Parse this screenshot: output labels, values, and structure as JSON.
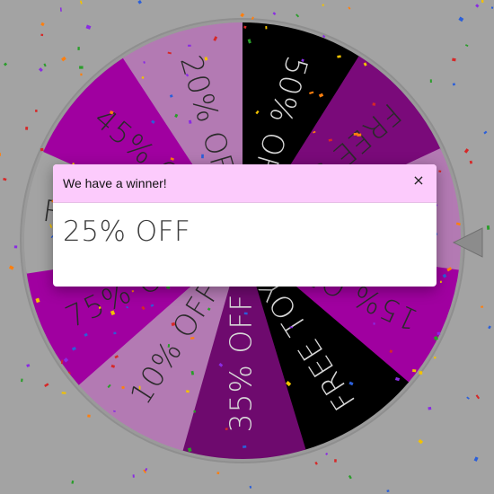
{
  "wheel": {
    "segments": [
      {
        "label": "50% OFF",
        "color": "#000000",
        "text_color": "#d8d8d8"
      },
      {
        "label": "FREE SHIP",
        "color": "#7a0a7a",
        "text_color": "#2a2a2a"
      },
      {
        "label": "25% OFF",
        "color": "#b37ab3",
        "text_color": "#2a2a2a"
      },
      {
        "label": "15% OFF",
        "color": "#a000a0",
        "text_color": "#2a2a2a"
      },
      {
        "label": "FREE TOY",
        "color": "#000000",
        "text_color": "#d8d8d8"
      },
      {
        "label": "35% OFF",
        "color": "#6e0a6e",
        "text_color": "#d8d8d8"
      },
      {
        "label": "10% OFF",
        "color": "#b37ab3",
        "text_color": "#2a2a2a"
      },
      {
        "label": "75% OFF",
        "color": "#a000a0",
        "text_color": "#2a2a2a"
      },
      {
        "label": "FREE GIFT",
        "color": "#a3a3a3",
        "text_color": "#2a2a2a"
      },
      {
        "label": "45% OFF",
        "color": "#a000a0",
        "text_color": "#2a2a2a"
      },
      {
        "label": "20% OFF",
        "color": "#b37ab3",
        "text_color": "#2a2a2a"
      }
    ],
    "confetti_colors": [
      "#d62828",
      "#2a9d2a",
      "#f2c200",
      "#2b5fd9",
      "#8a2be2",
      "#ff7f0e"
    ]
  },
  "modal": {
    "title": "We have a winner!",
    "close_symbol": "×",
    "prize": "25% OFF"
  },
  "colors": {
    "background": "#a3a3a3",
    "modal_header": "#fccbfc",
    "pointer": "#8c8c8c"
  }
}
